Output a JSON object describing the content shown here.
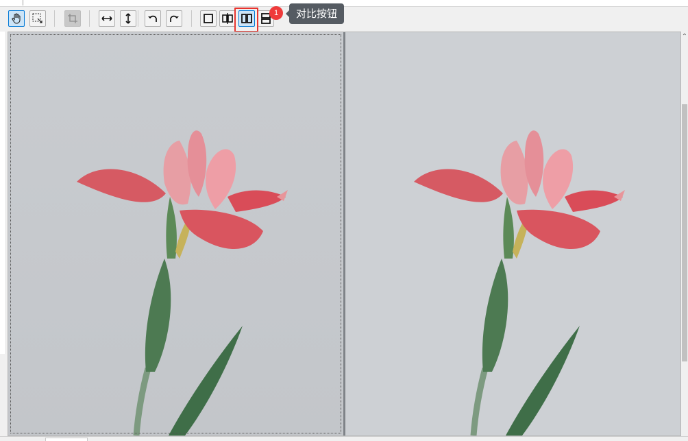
{
  "toolbar": {
    "buttons": [
      {
        "id": "pan",
        "icon": "hand-icon",
        "active": true
      },
      {
        "id": "select",
        "icon": "marquee-select-icon",
        "active": false
      },
      {
        "id": "crop",
        "icon": "crop-icon",
        "disabled": true
      },
      {
        "id": "flip-horizontal",
        "icon": "horizontal-arrows-icon"
      },
      {
        "id": "flip-vertical",
        "icon": "vertical-arrows-icon"
      },
      {
        "id": "rotate-left",
        "icon": "rotate-left-icon"
      },
      {
        "id": "rotate-right",
        "icon": "rotate-right-icon"
      },
      {
        "id": "single-view",
        "icon": "single-square-icon"
      },
      {
        "id": "split-view",
        "icon": "split-compare-icon"
      },
      {
        "id": "side-by-side",
        "icon": "side-by-side-icon",
        "active": true
      },
      {
        "id": "top-bottom",
        "icon": "top-bottom-icon"
      }
    ]
  },
  "annotation": {
    "badge": "1",
    "tooltip": "对比按钮",
    "highlight_color": "#e8342e",
    "badge_color": "#ef3b3b"
  },
  "panes": [
    {
      "id": "original",
      "selected": true
    },
    {
      "id": "processed",
      "selected": false
    }
  ],
  "colors": {
    "background": "#c6c9cd",
    "petal": "#d95a62",
    "stem": "#4f7a55",
    "active_button": "#cce4f7",
    "tooltip_bg": "#555b62"
  }
}
